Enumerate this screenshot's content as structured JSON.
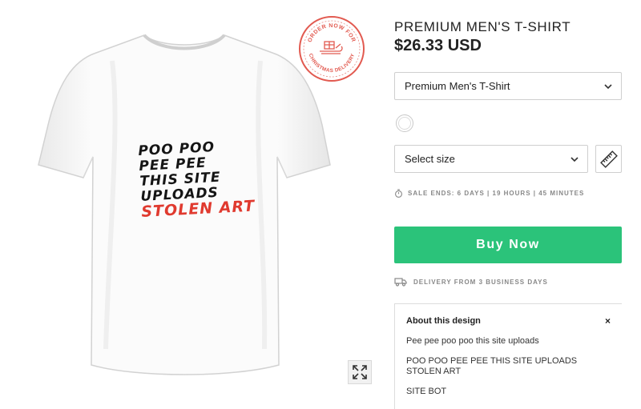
{
  "stamp": {
    "text_top": "ORDER NOW FOR",
    "text_bottom": "CHRISTMAS DELIVERY",
    "accent": "#e25a50"
  },
  "shirt_print": {
    "line1": "POO POO",
    "line2": "PEE PEE",
    "line3": "THIS SITE",
    "line4": "UPLOADS",
    "line5": "STOLEN ART"
  },
  "product": {
    "title": "PREMIUM MEN'S T-SHIRT",
    "price": "$26.33 USD"
  },
  "style_select": {
    "value": "Premium Men's T-Shirt",
    "icon": "chevron-down-icon"
  },
  "color_options": [
    {
      "color": "#ffffff",
      "selected": true
    }
  ],
  "size_select": {
    "value": "Select size",
    "icon": "chevron-down-icon"
  },
  "size_guide": {
    "icon": "ruler-icon"
  },
  "sale": {
    "icon": "stopwatch-icon",
    "text": "SALE ENDS: 6 DAYS | 19 HOURS | 45 MINUTES"
  },
  "buy_button": {
    "label": "Buy Now",
    "color": "#2bc37a"
  },
  "delivery": {
    "icon": "truck-icon",
    "text": "DELIVERY FROM 3 BUSINESS DAYS"
  },
  "about": {
    "title": "About this design",
    "close_label": "×",
    "paragraphs": [
      "Pee pee poo poo this site uploads",
      "POO POO PEE PEE THIS SITE UPLOADS STOLEN ART",
      "SITE BOT"
    ]
  },
  "expand_button": {
    "icon": "expand-icon"
  }
}
